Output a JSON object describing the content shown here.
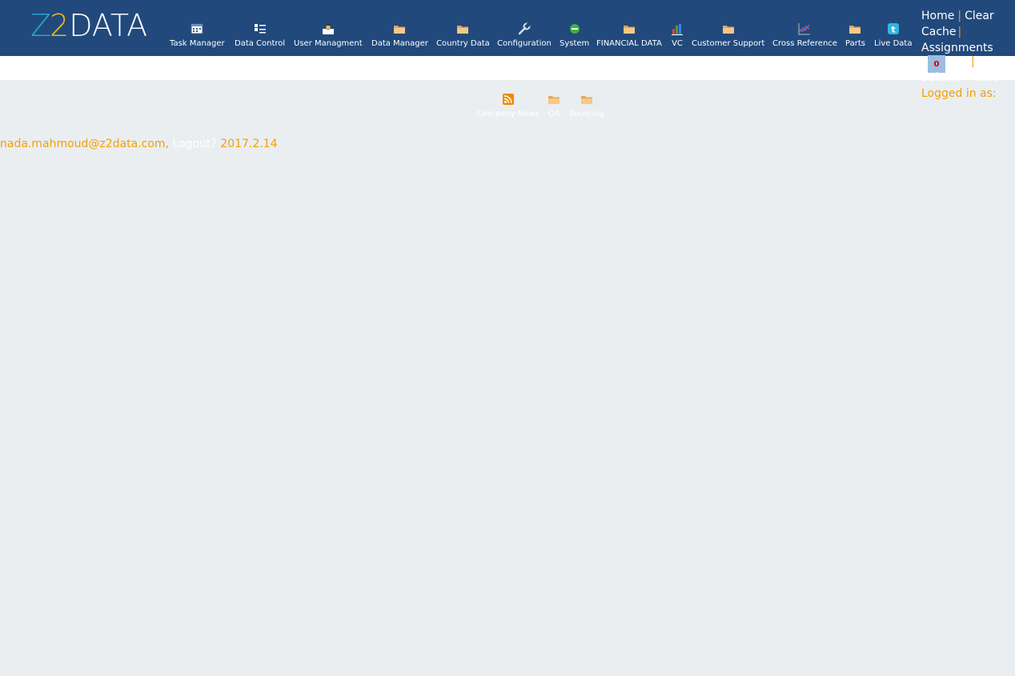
{
  "app": {
    "logo_text_z1": "Z",
    "logo_text_z2": "2",
    "logo_text_rest": "DATA"
  },
  "nav": [
    {
      "label": "Task Manager",
      "icon": "calendar-icon"
    },
    {
      "label": "Data Control",
      "icon": "checklist-icon"
    },
    {
      "label": "User Managment",
      "icon": "user-upload-icon"
    },
    {
      "label": "Data Manager",
      "icon": "folder-icon"
    },
    {
      "label": "Country Data",
      "icon": "folder-icon"
    },
    {
      "label": "Configuration",
      "icon": "wrench-icon"
    },
    {
      "label": "System",
      "icon": "green-circle-icon"
    },
    {
      "label": "FINANCIAL DATA",
      "icon": "folder-icon"
    },
    {
      "label": "VC",
      "icon": "bar-chart-icon"
    },
    {
      "label": "Customer Support",
      "icon": "folder-icon"
    },
    {
      "label": "Cross Reference",
      "icon": "line-chart-icon"
    },
    {
      "label": "Parts",
      "icon": "folder-icon"
    },
    {
      "label": "Live Data",
      "icon": "twitter-icon"
    }
  ],
  "userbox": {
    "home": "Home",
    "clear_cache_1": "Clear",
    "clear_cache_2": "Cache",
    "assignments": "Assignments",
    "badge_count": "0",
    "submit_ticket": "Submit Ticket",
    "logged_in_as": "Logged in as:",
    "separator": "|"
  },
  "subnav": [
    {
      "label": "Company News",
      "icon": "rss-icon"
    },
    {
      "label": "QA",
      "icon": "folder-icon"
    },
    {
      "label": "Sourcing",
      "icon": "folder-icon"
    }
  ],
  "footer": {
    "email": "nada.mahmoud@z2data.com",
    "comma": ",",
    "logout": "Logout?",
    "version": "2017.2.14"
  },
  "colors": {
    "header_bg": "#21497c",
    "accent": "#f4a000",
    "page_bg": "#eaeef1"
  }
}
